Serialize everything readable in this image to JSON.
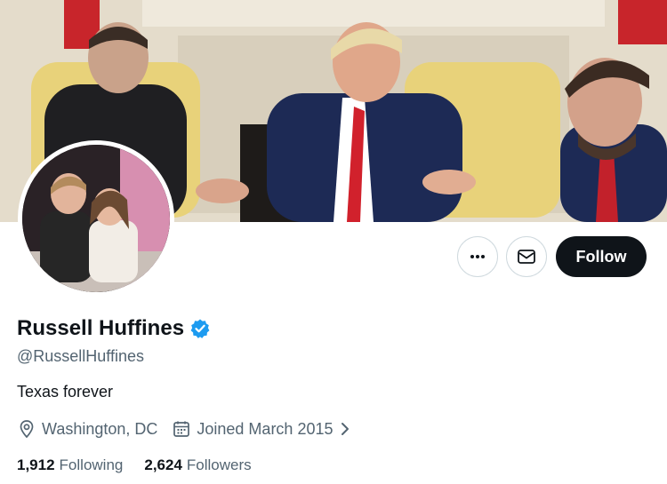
{
  "profile": {
    "display_name": "Russell Huffines",
    "handle": "@RussellHuffines",
    "bio": "Texas forever",
    "location": "Washington, DC",
    "joined": "Joined March 2015",
    "verified_badge_color": "#1d9bf0"
  },
  "actions": {
    "more_label": "•••",
    "follow_label": "Follow"
  },
  "stats": {
    "following_count": "1,912",
    "following_label": "Following",
    "followers_count": "2,624",
    "followers_label": "Followers"
  },
  "icons": {
    "more": "more-icon",
    "message": "envelope-icon",
    "location": "location-pin-icon",
    "calendar": "calendar-icon",
    "verified": "verified-badge-icon",
    "chevron": "chevron-right-icon"
  },
  "colors": {
    "text_primary": "#0f1419",
    "text_secondary": "#536471",
    "button_dark": "#0f1419",
    "border": "#cfd9de"
  }
}
